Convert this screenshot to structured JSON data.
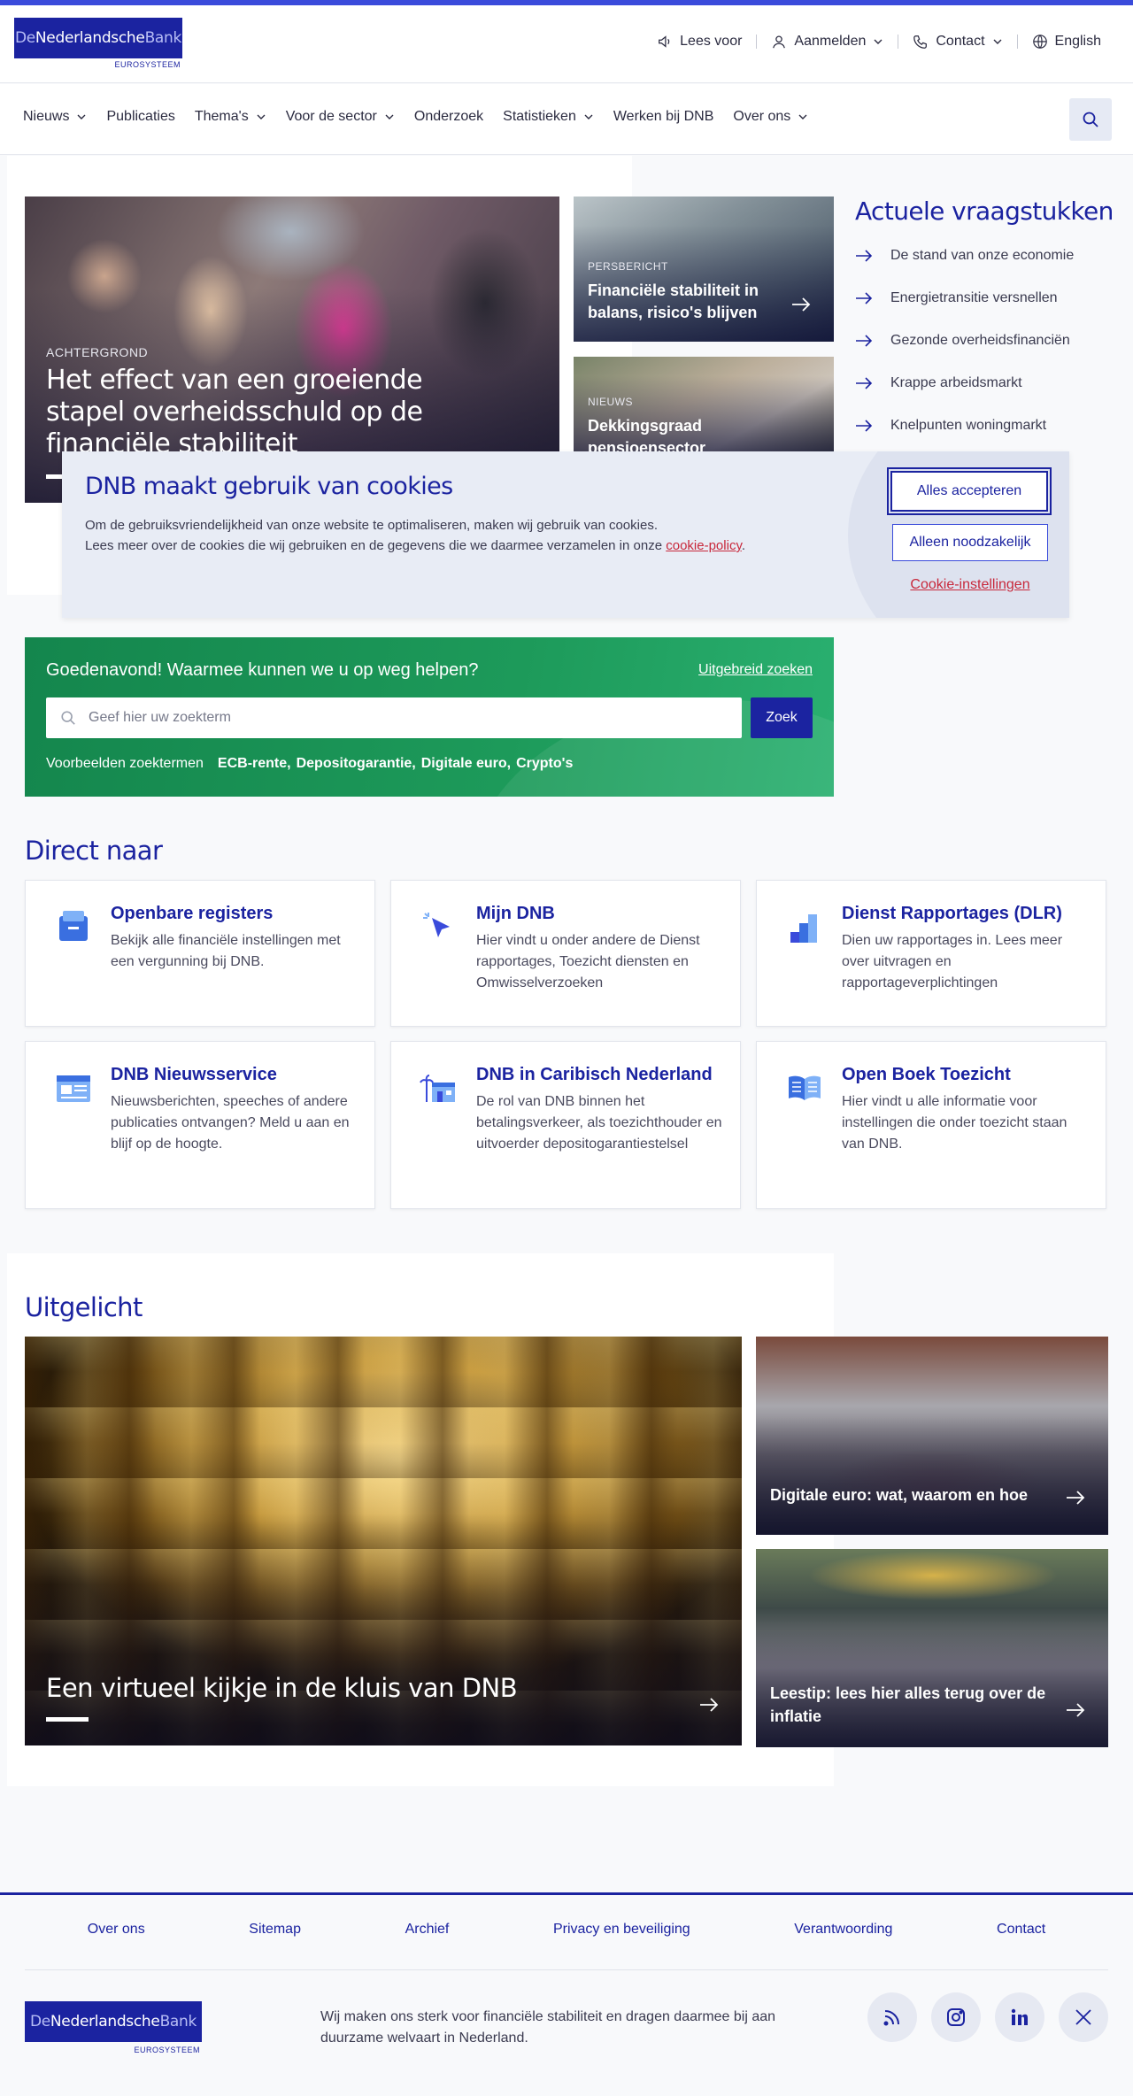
{
  "header": {
    "logo": {
      "part1": "De",
      "part2": "Nederlandsche",
      "part3": "Bank",
      "sub": "EUROSYSTEEM"
    },
    "utility": [
      {
        "label": "Lees voor",
        "icon": "speaker-icon"
      },
      {
        "label": "Aanmelden",
        "icon": "user-icon"
      },
      {
        "label": "Contact",
        "icon": "phone-icon"
      },
      {
        "label": "English",
        "icon": "globe-icon"
      }
    ]
  },
  "nav": {
    "items": [
      {
        "label": "Nieuws",
        "dropdown": true
      },
      {
        "label": "Publicaties",
        "dropdown": false
      },
      {
        "label": "Thema's",
        "dropdown": true
      },
      {
        "label": "Voor de sector",
        "dropdown": true
      },
      {
        "label": "Onderzoek",
        "dropdown": false
      },
      {
        "label": "Statistieken",
        "dropdown": true
      },
      {
        "label": "Werken bij DNB",
        "dropdown": false
      },
      {
        "label": "Over ons",
        "dropdown": true
      }
    ]
  },
  "hero": {
    "kicker": "ACHTERGROND",
    "title": "Het effect van een groeiende stapel overheidsschuld op de financiële stabiliteit"
  },
  "teasers": [
    {
      "kicker": "PERSBERICHT",
      "title": "Financiële stabiliteit in balans, risico's blijven"
    },
    {
      "kicker": "NIEUWS",
      "title": "Dekkingsgraad pensioensector"
    }
  ],
  "actueel": {
    "heading": "Actuele vraagstukken",
    "items": [
      "De stand van onze economie",
      "Energietransitie versnellen",
      "Gezonde overheidsfinanciën",
      "Krappe arbeidsmarkt",
      "Knelpunten woningmarkt"
    ]
  },
  "cookie": {
    "heading": "DNB maakt gebruik van cookies",
    "line1": "Om de gebruiksvriendelijkheid van onze website te optimaliseren, maken wij gebruik van cookies.",
    "line2": "Lees meer over de cookies die wij gebruiken en de gegevens die we daarmee verzamelen in onze ",
    "policy_link": "cookie-policy",
    "period": ".",
    "accept": "Alles accepteren",
    "necessary": "Alleen noodzakelijk",
    "settings": "Cookie-instellingen"
  },
  "search": {
    "greeting": "Goedenavond! Waarmee kunnen we u op weg helpen?",
    "advanced": "Uitgebreid zoeken",
    "placeholder": "Geef hier uw zoekterm",
    "button": "Zoek",
    "examples_label": "Voorbeelden zoektermen",
    "examples": [
      "ECB-rente",
      "Depositogarantie",
      "Digitale euro",
      "Crypto's"
    ]
  },
  "direct": {
    "heading": "Direct naar",
    "cards": [
      {
        "title": "Openbare registers",
        "desc": "Bekijk alle financiële instellingen met een vergunning bij DNB.",
        "icon": "register-icon"
      },
      {
        "title": "Mijn DNB",
        "desc": "Hier vindt u onder andere de Dienst rapportages, Toezicht diensten en Omwisselverzoeken",
        "icon": "cursor-click-icon"
      },
      {
        "title": "Dienst Rapportages (DLR)",
        "desc": "Dien uw rapportages in. Lees meer over uitvragen en rapportageverplichtingen",
        "icon": "bar-stairs-icon"
      },
      {
        "title": "DNB Nieuwsservice",
        "desc": "Nieuwsberichten, speeches of andere publicaties ontvangen? Meld u aan en blijf op de hoogte.",
        "icon": "newsletter-icon"
      },
      {
        "title": "DNB in Caribisch Nederland",
        "desc": "De rol van DNB binnen het betalingsverkeer, als toezichthouder en uitvoerder depositogarantiestelsel",
        "icon": "palm-building-icon"
      },
      {
        "title": "Open Boek Toezicht",
        "desc": "Hier vindt u alle informatie voor instellingen die onder toezicht staan van DNB.",
        "icon": "open-book-icon"
      }
    ]
  },
  "uitgelicht": {
    "heading": "Uitgelicht",
    "main": "Een virtueel kijkje in de kluis van DNB",
    "side": [
      "Digitale euro: wat, waarom en hoe",
      "Leestip: lees hier alles terug over de inflatie"
    ]
  },
  "footer": {
    "links": [
      "Over ons",
      "Sitemap",
      "Archief",
      "Privacy en beveiliging",
      "Verantwoording",
      "Contact"
    ],
    "text": "Wij maken ons sterk voor financiële stabiliteit en dragen daarmee bij aan duurzame welvaart in Nederland.",
    "socials": [
      "rss-icon",
      "instagram-icon",
      "linkedin-icon",
      "x-icon"
    ]
  },
  "colors": {
    "brand": "#1b23a0",
    "accent": "#3a4bdb",
    "green": "#1d9a5a",
    "link_red": "#c8283b"
  }
}
